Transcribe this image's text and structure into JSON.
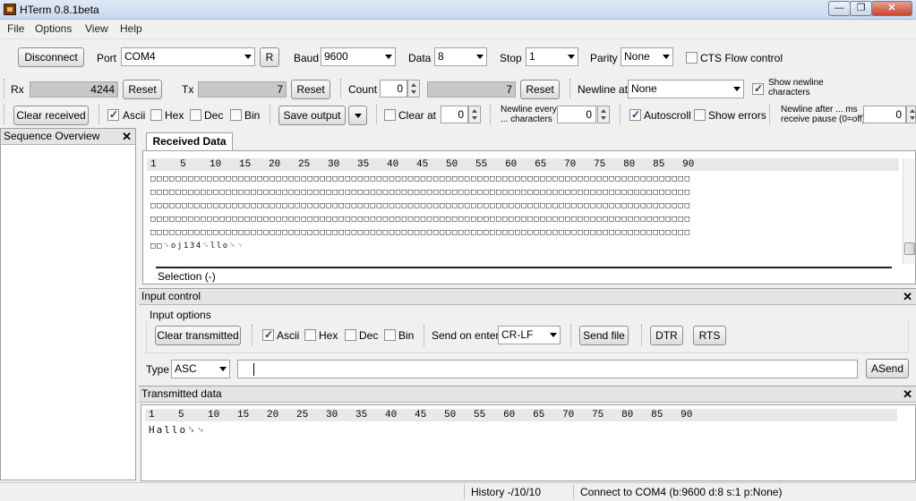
{
  "window": {
    "title": "HTerm 0.8.1beta",
    "min": "—",
    "max": "❐",
    "close": "✕"
  },
  "menu": [
    "File",
    "Options",
    "View",
    "Help"
  ],
  "conn": {
    "disconnect": "Disconnect",
    "port_label": "Port",
    "port": "COM4",
    "r": "R",
    "baud_label": "Baud",
    "baud": "9600",
    "data_label": "Data",
    "data": "8",
    "stop_label": "Stop",
    "stop": "1",
    "parity_label": "Parity",
    "parity": "None",
    "cts": "CTS Flow control"
  },
  "counters": {
    "rx_label": "Rx",
    "rx": "4244",
    "reset": "Reset",
    "tx_label": "Tx",
    "tx": "7",
    "count_label": "Count",
    "count": "0",
    "count_val": "7",
    "newline_at_label": "Newline at",
    "newline_at": "None",
    "show_newline": "Show newline characters"
  },
  "rxopts": {
    "clear_received": "Clear received",
    "ascii": "Ascii",
    "hex": "Hex",
    "dec": "Dec",
    "bin": "Bin",
    "save_output": "Save output",
    "clear_at": "Clear at",
    "clear_at_val": "0",
    "newline_every": "Newline every ... characters",
    "newline_every_val": "0",
    "autoscroll": "Autoscroll",
    "show_errors": "Show errors",
    "newline_after": "Newline after ... ms receive pause (0=off)",
    "newline_after_val": "0"
  },
  "sequence": {
    "title": "Sequence Overview"
  },
  "received": {
    "tab": "Received Data",
    "ruler": "1    5    10   15   20   25   30   35   40   45   50   55   60   65   70   75   80   85   90",
    "lines": [
      "□□□□□□□□□□□□□□□□□□□□□□□□□□□□□□□□□□□□□□□□□□□□□□□□□□□□□□□□□□□□□□□□□□□□□□□□□□□□□□□□□□□□□□",
      "□□□□□□□□□□□□□□□□□□□□□□□□□□□□□□□□□□□□□□□□□□□□□□□□□□□□□□□□□□□□□□□□□□□□□□□□□□□□□□□□□□□□□□",
      "□□□□□□□□□□□□□□□□□□□□□□□□□□□□□□□□□□□□□□□□□□□□□□□□□□□□□□□□□□□□□□□□□□□□□□□□□□□□□□□□□□□□□□",
      "□□□□□□□□□□□□□□□□□□□□□□□□□□□□□□□□□□□□□□□□□□□□□□□□□□□□□□□□□□□□□□□□□□□□□□□□□□□□□□□□□□□□□□",
      "□□□□□□□□□□□□□□□□□□□□□□□□□□□□□□□□□□□□□□□□□□□□□□□□□□□□□□□□□□□□□□□□□□□□□□□□□□□□□□□□□□□□□□",
      "□□␍oj134␍llo␍␊"
    ],
    "selection": "Selection (-)"
  },
  "input": {
    "title": "Input control",
    "options_label": "Input options",
    "clear_transmitted": "Clear transmitted",
    "ascii": "Ascii",
    "hex": "Hex",
    "dec": "Dec",
    "bin": "Bin",
    "send_on_enter": "Send on enter",
    "send_on_enter_val": "CR-LF",
    "send_file": "Send file",
    "dtr": "DTR",
    "rts": "RTS",
    "type_label": "Type",
    "type_val": "ASC",
    "input_value": "",
    "asend": "ASend"
  },
  "transmitted": {
    "title": "Transmitted data",
    "ruler": "1    5    10   15   20   25   30   35   40   45   50   55   60   65   70   75   80   85   90",
    "line": "Hallo␍␊"
  },
  "status": {
    "history": "History -/10/10",
    "connection": "Connect to COM4 (b:9600 d:8 s:1 p:None)"
  }
}
